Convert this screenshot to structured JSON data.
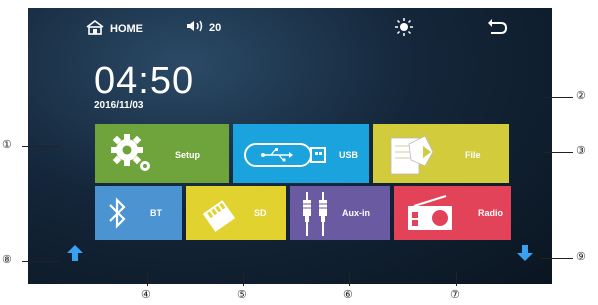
{
  "statusbar": {
    "home_label": "HOME",
    "volume_value": "20"
  },
  "clock": {
    "time": "04:50",
    "date": "2016/11/03"
  },
  "tiles": {
    "setup": {
      "label": "Setup",
      "color": "#6fa43c"
    },
    "usb": {
      "label": "USB",
      "color": "#1ba3de"
    },
    "file": {
      "label": "File",
      "color": "#d2cb3c"
    },
    "bt": {
      "label": "BT",
      "color": "#4b93d1"
    },
    "sd": {
      "label": "SD",
      "color": "#e1d22f"
    },
    "aux": {
      "label": "Aux-in",
      "color": "#6a5aa2"
    },
    "radio": {
      "label": "Radio",
      "color": "#e24358"
    }
  },
  "callouts": {
    "c1": "①",
    "c2": "②",
    "c3": "③",
    "c4": "④",
    "c5": "⑤",
    "c6": "⑥",
    "c7": "⑦",
    "c8": "⑧",
    "c9": "⑨"
  }
}
